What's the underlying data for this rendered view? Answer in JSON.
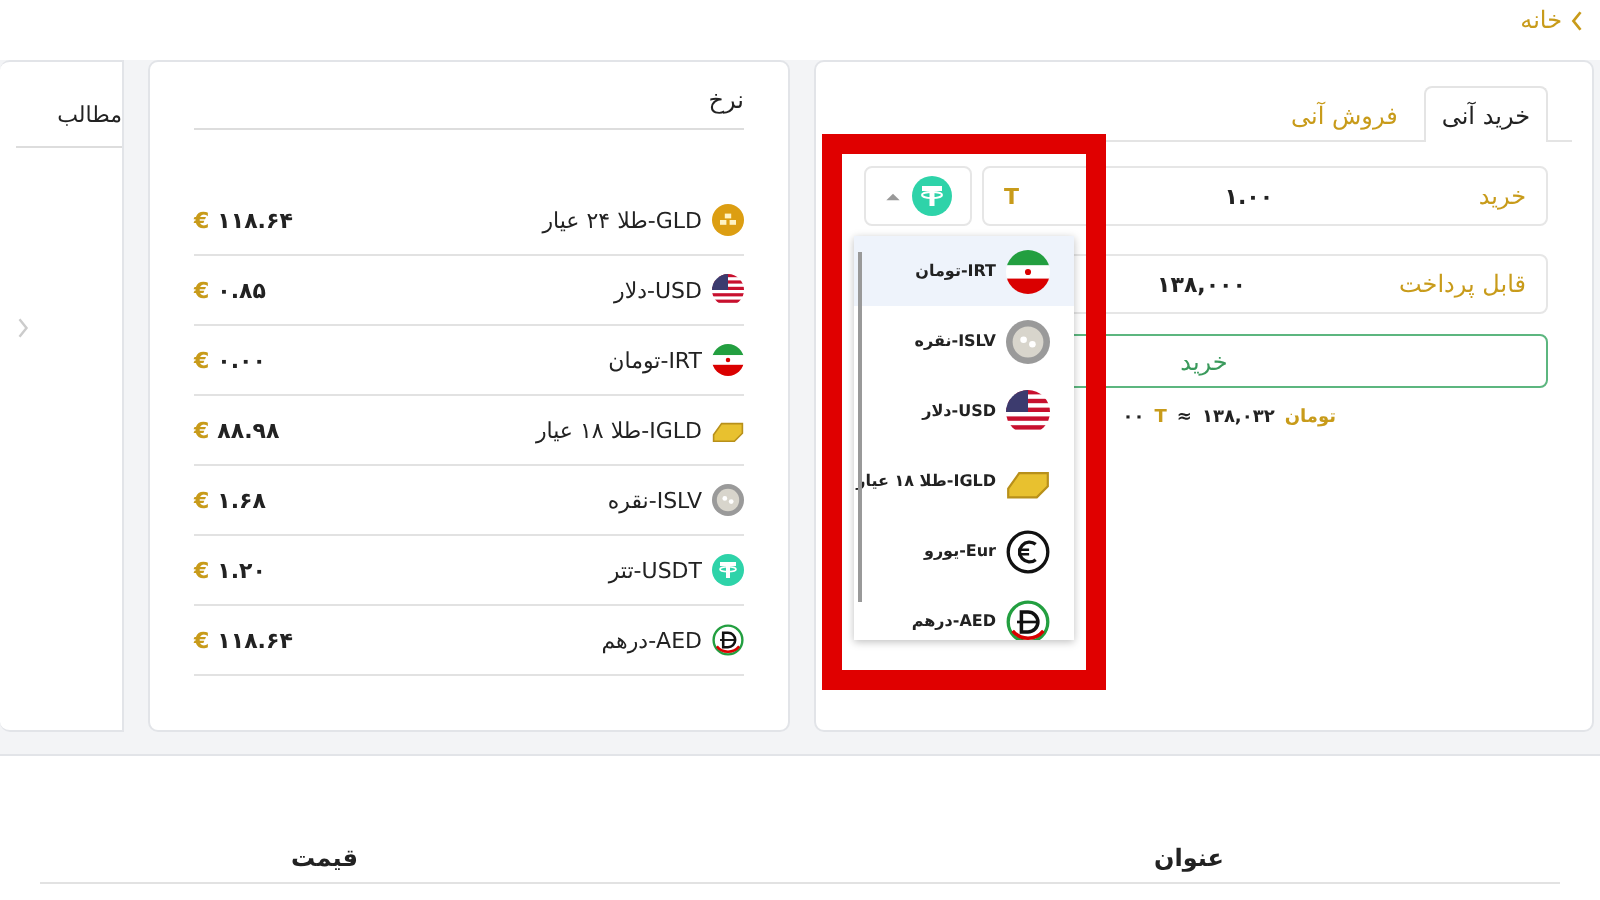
{
  "breadcrumb": {
    "label": "خانه"
  },
  "buy_panel": {
    "tabs": [
      {
        "label": "خرید آنی",
        "selected": true
      },
      {
        "label": "فروش آنی",
        "selected": false
      }
    ],
    "amount_field": {
      "label": "خرید",
      "value": "۱.۰۰",
      "unit": "T"
    },
    "currency_select": {
      "expanded": true
    },
    "pay_field": {
      "label": "قابل پرداخت",
      "value": "۱۳۸,۰۰۰"
    },
    "submit_button": "خرید",
    "conversion": {
      "to_unit": "تومان",
      "to_amount": "۱۳۸,۰۳۲",
      "approx": "≈",
      "from_unit": "T",
      "from_amount": "۰۰"
    },
    "dropdown": [
      {
        "label": "IRT-تومان",
        "selected": true
      },
      {
        "label": "ISLV-نقره",
        "selected": false
      },
      {
        "label": "USD-دلار",
        "selected": false
      },
      {
        "label": "IGLD-طلا ۱۸ عیار",
        "selected": false
      },
      {
        "label": "Eur-یورو",
        "selected": false
      },
      {
        "label": "AED-درهم",
        "selected": false
      }
    ]
  },
  "rates_panel": {
    "title": "نرخ",
    "rows": [
      {
        "name": "GLD-طلا ۲۴ عیار",
        "symbol": "€",
        "price": "۱۱۸.۶۴"
      },
      {
        "name": "USD-دلار",
        "symbol": "€",
        "price": "۰.۸۵"
      },
      {
        "name": "IRT-تومان",
        "symbol": "€",
        "price": "۰.۰۰"
      },
      {
        "name": "IGLD-طلا ۱۸ عیار",
        "symbol": "€",
        "price": "۸۸.۹۸"
      },
      {
        "name": "ISLV-نقره",
        "symbol": "€",
        "price": "۱.۶۸"
      },
      {
        "name": "USDT-تتر",
        "symbol": "€",
        "price": "۱.۲۰"
      },
      {
        "name": "AED-درهم",
        "symbol": "€",
        "price": "۱۱۸.۶۴"
      }
    ]
  },
  "side_panel": {
    "title": "مطالب"
  },
  "table": {
    "columns": [
      "عنوان",
      "قیمت"
    ]
  }
}
